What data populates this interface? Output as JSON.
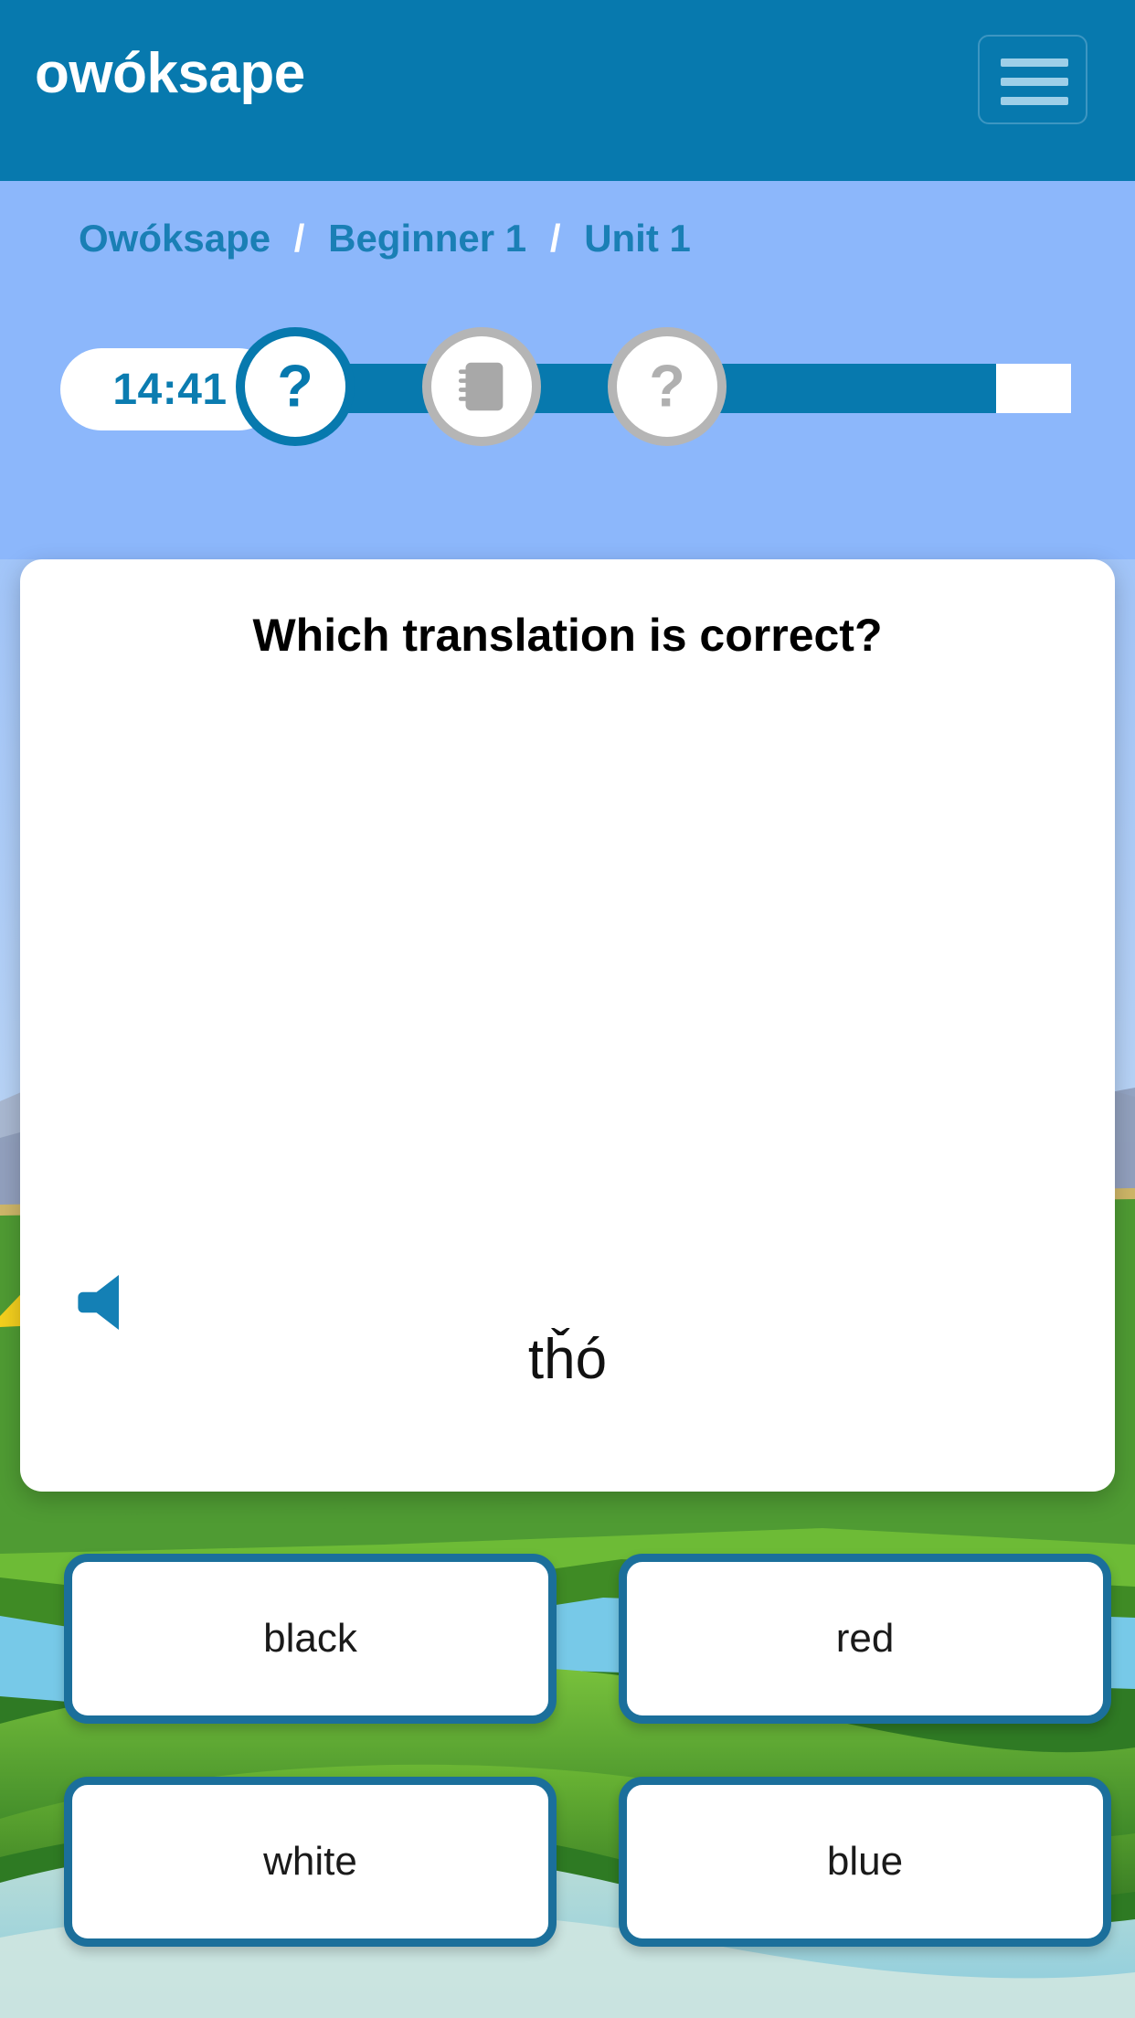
{
  "appbar": {
    "title": "owóksape",
    "menu_label": "menu",
    "brand_color": "#0779ae"
  },
  "breadcrumb": {
    "separator": "/",
    "items": [
      {
        "label": "Owóksape"
      },
      {
        "label": "Beginner 1"
      },
      {
        "label": "Unit 1"
      }
    ]
  },
  "progress": {
    "timer": "14:41",
    "steps": [
      {
        "icon": "question-mark-icon",
        "state": "active"
      },
      {
        "icon": "notebook-icon",
        "state": "completed"
      },
      {
        "icon": "question-mark-icon",
        "state": "pending"
      }
    ],
    "fill_percent": 90,
    "active_color": "#0779ae",
    "inactive_color": "#b5b5b5"
  },
  "card": {
    "title": "Which translation is correct?",
    "audio_icon": "speaker-icon",
    "prompt_word": "tȟó",
    "answers": [
      {
        "label": "black"
      },
      {
        "label": "red"
      },
      {
        "label": "white"
      },
      {
        "label": "blue"
      }
    ],
    "answer_border_color": "#1b6f9b"
  }
}
